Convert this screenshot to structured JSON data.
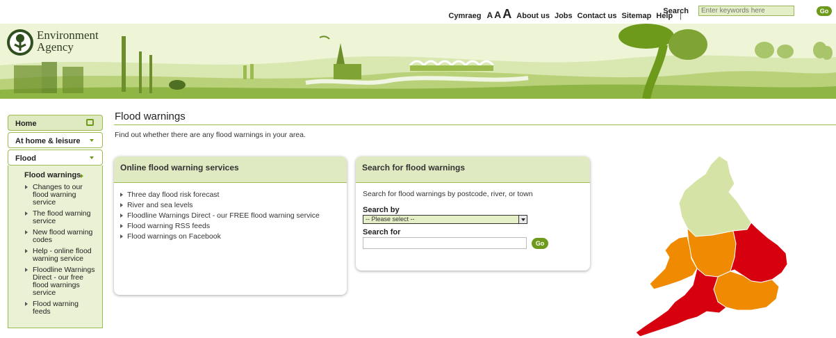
{
  "topnav": {
    "cymraeg": "Cymraeg",
    "text_size": [
      "A",
      "A",
      "A"
    ],
    "about": "About us",
    "jobs": "Jobs",
    "contact": "Contact us",
    "sitemap": "Sitemap",
    "help": "Help",
    "separator": "|",
    "search_label": "Search",
    "search_placeholder": "Enter keywords here",
    "go": "Go"
  },
  "logo": {
    "line1": "Environment",
    "line2": "Agency"
  },
  "leftnav": {
    "home": "Home",
    "at_home": "At home & leisure",
    "flood": "Flood",
    "current": "Flood warnings",
    "subitems": [
      "Changes to our flood warning service",
      "The flood warning service",
      "New flood warning codes",
      "Help - online flood warning service",
      "Floodline Warnings Direct - our free flood warnings service",
      "Flood warning feeds"
    ]
  },
  "page": {
    "title": "Flood warnings",
    "intro": "Find out whether there are any flood warnings in your area."
  },
  "services": {
    "heading": "Online flood warning services",
    "links": [
      "Three day flood risk forecast",
      "River and sea levels",
      "Floodline Warnings Direct - our FREE flood warning service",
      "Flood warning RSS feeds",
      "Flood warnings on Facebook"
    ]
  },
  "search_box": {
    "heading": "Search for flood warnings",
    "description": "Search for flood warnings by postcode, river, or town",
    "search_by_label": "Search by",
    "search_by_value": "-- Please select --",
    "search_for_label": "Search for",
    "go": "Go"
  },
  "colors": {
    "brand_green": "#6e9a1c",
    "panel_green": "#dfe9c2",
    "map_low": "#d6e3a6",
    "map_medium": "#f08a00",
    "map_high": "#d7000f"
  }
}
